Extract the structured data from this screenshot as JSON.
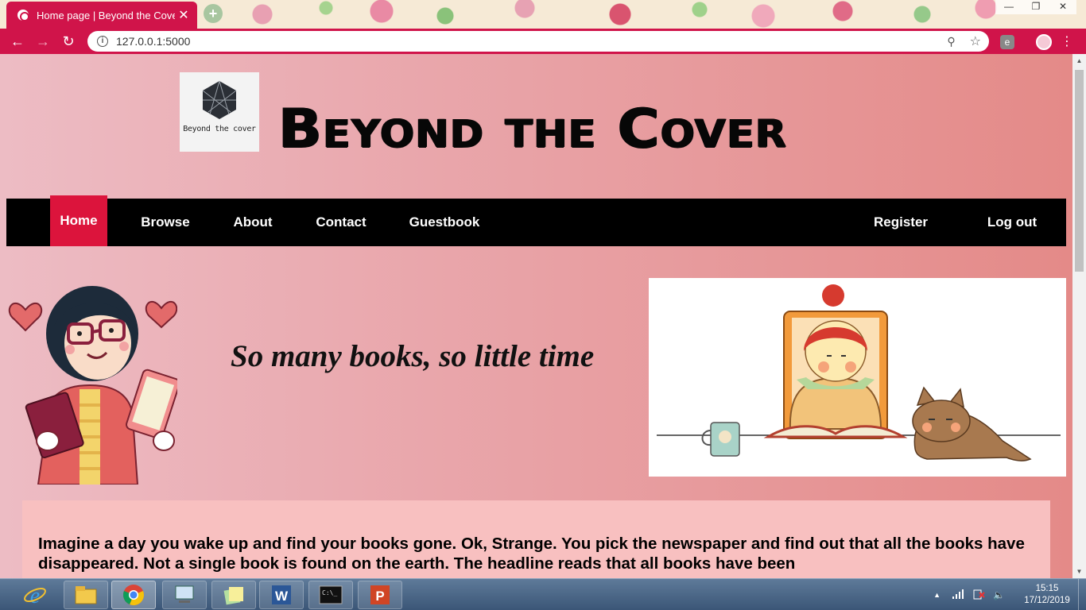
{
  "browser": {
    "tab_title": "Home page | Beyond the Cover",
    "tab_close": "✕",
    "new_tab": "+",
    "url": "127.0.0.1:5000",
    "ext_label": "e",
    "window_controls": [
      "—",
      "❐",
      "✕"
    ]
  },
  "site": {
    "logo_caption": "Beyond the cover",
    "title": "Beyond the Cover"
  },
  "nav": {
    "left": [
      "Home",
      "Browse",
      "About",
      "Contact",
      "Guestbook"
    ],
    "right": [
      "Register",
      "Log out"
    ],
    "active": "Home",
    "active_color": "#dc143c"
  },
  "hero": {
    "slogan": "So many books, so little time"
  },
  "intro": {
    "text": "Imagine a day you wake up and find your books gone. Ok, Strange. You pick the newspaper and find out that all the books have disappeared. Not a single book is found on the earth. The headline reads that all books have been"
  },
  "taskbar": {
    "time": "15:15",
    "date": "17/12/2019",
    "apps": [
      "internet-explorer-icon",
      "file-explorer-icon",
      "chrome-icon",
      "remote-desktop-icon",
      "sticky-notes-icon",
      "word-icon",
      "cmd-icon",
      "powerpoint-icon"
    ]
  },
  "colors": {
    "chrome_accent": "#d0144a",
    "nav_bg": "#000000",
    "intro_bg": "#f8c0c0"
  }
}
